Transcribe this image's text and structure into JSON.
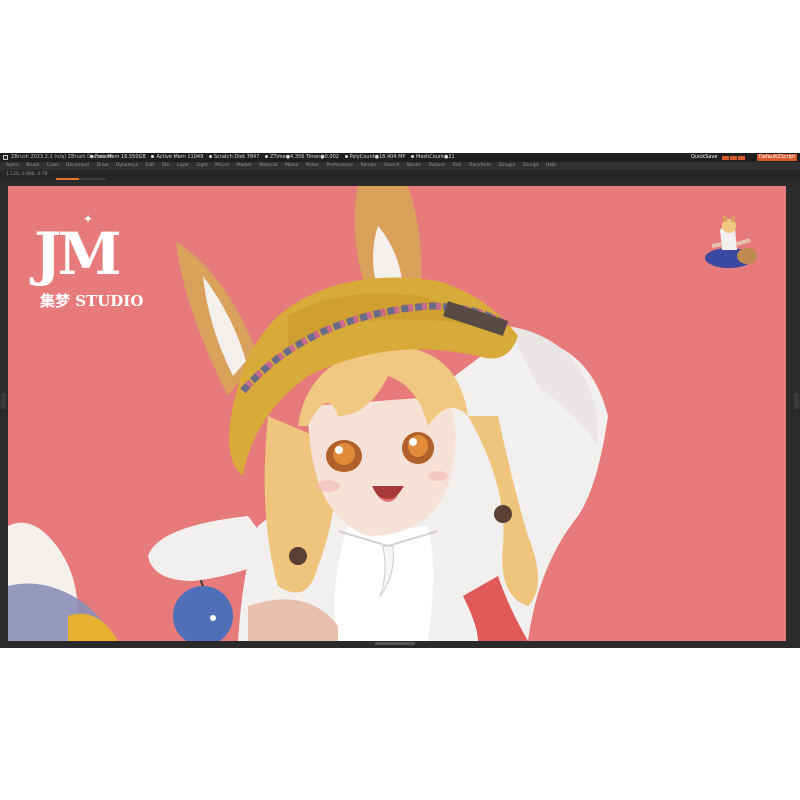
{
  "app": {
    "title": "ZBrush 2023.2.1 (n/a)   ZBrush Document",
    "stats": [
      "Free Mem 16.550GB",
      "Active Mem 11049",
      "Scratch Disk 7847",
      "ZTime●4.356 Timer●0.002",
      "PolyCount●18.404 MP",
      "MeshCount●21"
    ],
    "quicksave_label": "QuickSave",
    "default_script_label": "DefaultZScript"
  },
  "menu": {
    "items": [
      "Alpha",
      "Brush",
      "Color",
      "Document",
      "Draw",
      "Dynamics",
      "Edit",
      "File",
      "Layer",
      "Light",
      "Macro",
      "Marker",
      "Material",
      "Movie",
      "Picker",
      "Preferences",
      "Render",
      "Stencil",
      "Stroke",
      "Texture",
      "Tool",
      "Transform",
      "Zplugin",
      "Zscript",
      "Help"
    ]
  },
  "toolbar": {
    "label": "1.126, 0.988, 0.78",
    "progress": 0.45
  },
  "viewport": {
    "background": "#e77a7b",
    "logo": {
      "letters": "JM",
      "studio_text": "集梦 STUDIO"
    }
  },
  "colors": {
    "accent": "#d85a2a",
    "hat": "#d8aa3a",
    "hair": "#f0c882",
    "shirt": "#f0eeee"
  }
}
